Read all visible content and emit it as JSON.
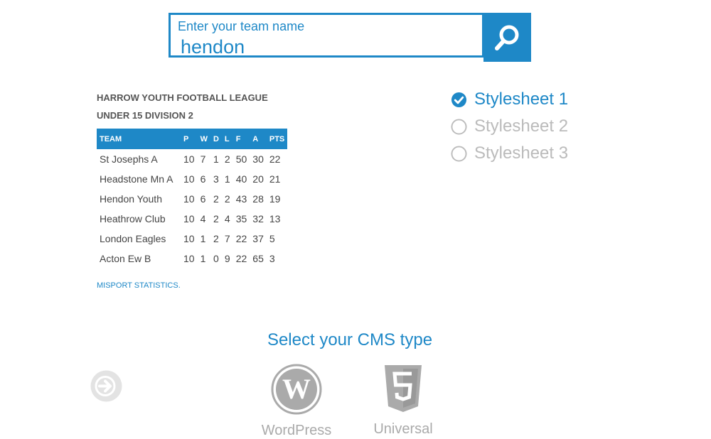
{
  "search": {
    "label": "Enter your team name",
    "value": "hendon",
    "button_icon": "search-icon"
  },
  "league": {
    "name": "HARROW YOUTH FOOTBALL LEAGUE",
    "division": "UNDER 15 DIVISION 2",
    "columns": [
      "TEAM",
      "P",
      "W",
      "D",
      "L",
      "F",
      "A",
      "PTS"
    ],
    "rows": [
      [
        "St Josephs A",
        "10",
        "7",
        "1",
        "2",
        "50",
        "30",
        "22"
      ],
      [
        "Headstone Mn A",
        "10",
        "6",
        "3",
        "1",
        "40",
        "20",
        "21"
      ],
      [
        "Hendon Youth",
        "10",
        "6",
        "2",
        "2",
        "43",
        "28",
        "19"
      ],
      [
        "Heathrow Club",
        "10",
        "4",
        "2",
        "4",
        "35",
        "32",
        "13"
      ],
      [
        "London Eagles",
        "10",
        "1",
        "2",
        "7",
        "22",
        "37",
        "5"
      ],
      [
        "Acton Ew B",
        "10",
        "1",
        "0",
        "9",
        "22",
        "65",
        "3"
      ]
    ],
    "footer_link": "MISPORT STATISTICS."
  },
  "stylesheets": {
    "options": [
      {
        "label": "Stylesheet 1",
        "selected": true
      },
      {
        "label": "Stylesheet 2",
        "selected": false
      },
      {
        "label": "Stylesheet 3",
        "selected": false
      }
    ]
  },
  "cms": {
    "heading": "Select your CMS type",
    "nav_icon": "arrow-right-circle-icon",
    "options": [
      {
        "label": "WordPress",
        "icon": "wordpress-icon"
      },
      {
        "label": "Universal",
        "icon": "html5-icon"
      }
    ]
  },
  "colors": {
    "accent": "#1e88c7",
    "muted": "#bbbbbb",
    "text": "#444444"
  }
}
